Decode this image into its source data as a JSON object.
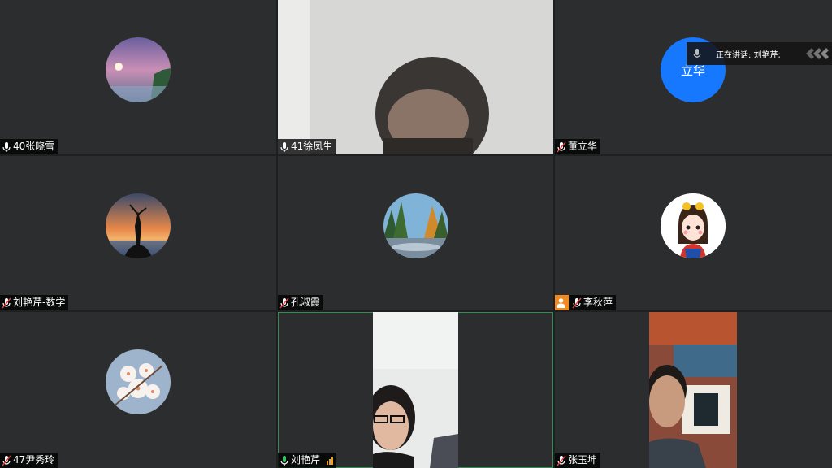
{
  "participants": [
    {
      "name": "40张晓雪",
      "mic": "on"
    },
    {
      "name": "41徐凤生",
      "mic": "on"
    },
    {
      "name": "董立华",
      "mic": "muted",
      "avatar_text": "立华"
    },
    {
      "name": "刘艳芹-数学",
      "mic": "muted"
    },
    {
      "name": "孔淑霞",
      "mic": "muted"
    },
    {
      "name": "李秋萍",
      "mic": "muted"
    },
    {
      "name": "47尹秀玲",
      "mic": "muted"
    },
    {
      "name": "刘艳芹",
      "mic": "speaking"
    },
    {
      "name": "张玉坤",
      "mic": "muted"
    }
  ],
  "speaking_banner": {
    "text": "正在讲话: 刘艳芹;"
  },
  "colors": {
    "active_border": "#2f8f4e",
    "host_badge": "#f08a24",
    "avatar_blue": "#1677ff"
  }
}
